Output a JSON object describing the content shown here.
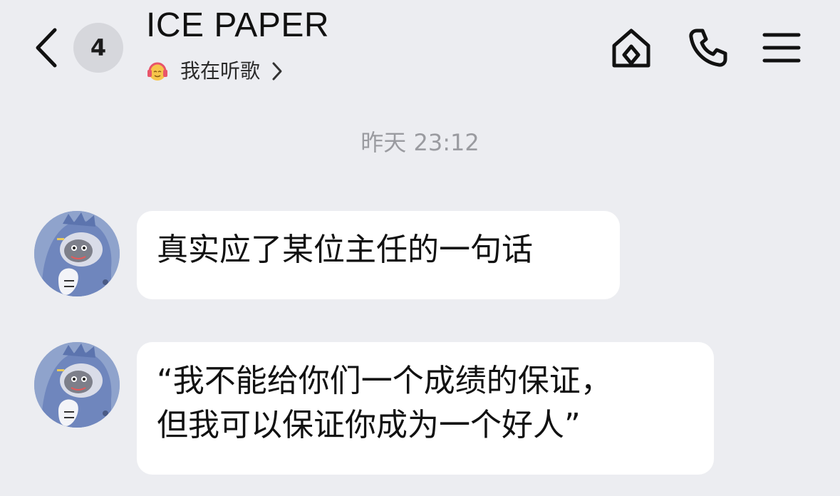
{
  "header": {
    "unread_count": "4",
    "title": "ICE PAPER",
    "status_text": "我在听歌"
  },
  "timestamp": "昨天 23:12",
  "messages": [
    {
      "text": "真实应了某位主任的一句话"
    },
    {
      "text": "“我不能给你们一个成绩的保证，\n但我可以保证你成为一个好人”"
    }
  ],
  "colors": {
    "background": "#ECEDF1",
    "bubble": "#FFFFFF",
    "badge": "#D6D7DC",
    "timestamp": "#9A9BA0",
    "avatar": "#8FA3CC"
  },
  "icons": [
    "back-chevron-icon",
    "headphones-emoji-icon",
    "chevron-right-icon",
    "home-icon",
    "phone-icon",
    "menu-icon"
  ]
}
